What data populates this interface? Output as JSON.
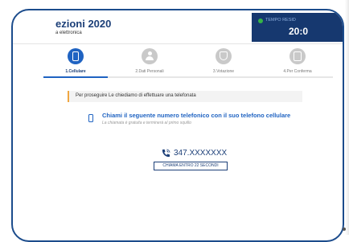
{
  "header": {
    "title": "ezioni 2020",
    "subtitle": "a elettronica"
  },
  "timer": {
    "label": "TEMPO RESID",
    "value": "20:0",
    "accent": "#16386f",
    "status_color": "#35b447"
  },
  "steps": [
    {
      "label": "1.Cellulare",
      "icon": "phone-icon",
      "active": true
    },
    {
      "label": "2.Dati Personali",
      "icon": "person-icon",
      "active": false
    },
    {
      "label": "3.Votazione",
      "icon": "shield-icon",
      "active": false
    },
    {
      "label": "4.Per Conferma",
      "icon": "document-icon",
      "active": false
    }
  ],
  "notice": {
    "text": "Per proseguire Le chiediamo di effettuare una telefonata",
    "accent": "#f0a640"
  },
  "instruction": {
    "heading": "Chiami il seguente numero telefonico con il suo telefono cellulare",
    "subheading": "La chiamata è gratuita e terminerà al primo squillo"
  },
  "call": {
    "number": "347.XXXXXXX",
    "button_label": "CHIAMA ENTRO 22 SECONDI",
    "brand_color": "#1c3f78"
  }
}
